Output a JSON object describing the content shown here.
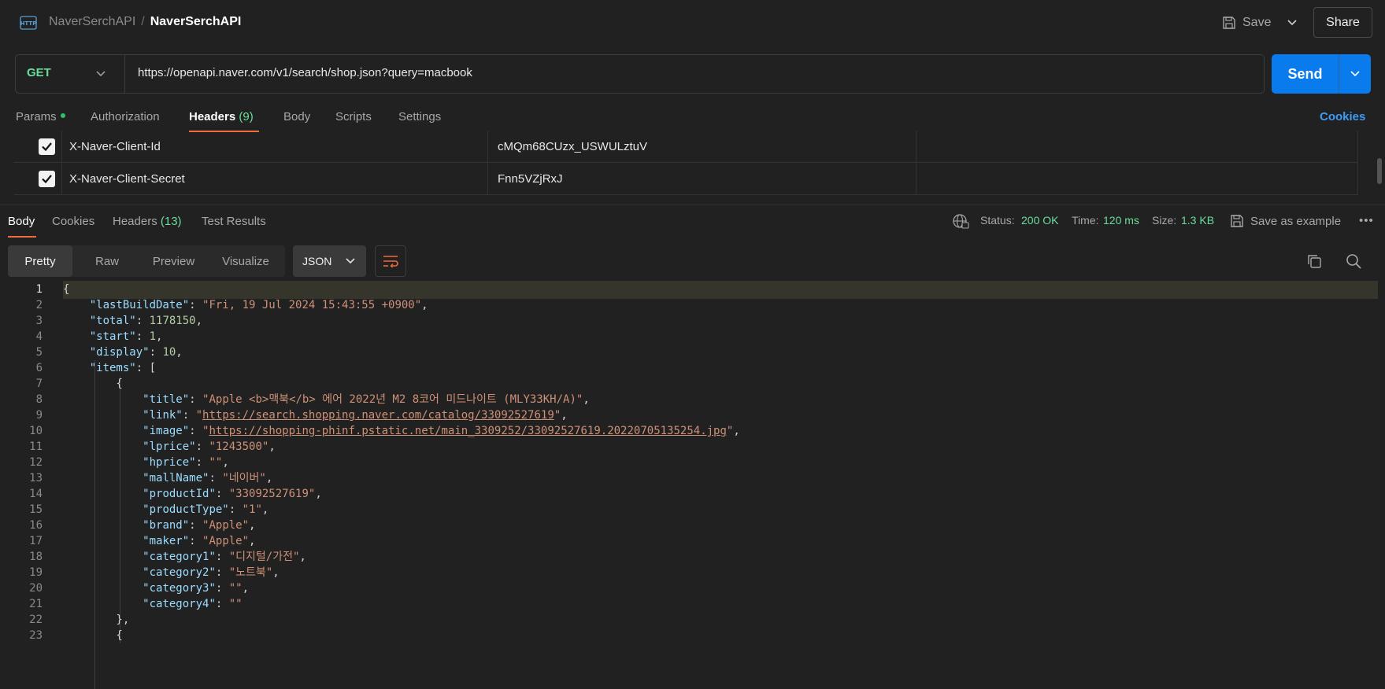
{
  "breadcrumb": {
    "parent": "NaverSerchAPI",
    "separator": "/",
    "current": "NaverSerchAPI"
  },
  "toolbar": {
    "save_label": "Save",
    "share_label": "Share"
  },
  "request": {
    "method": "GET",
    "url": "https://openapi.naver.com/v1/search/shop.json?query=macbook",
    "send_label": "Send"
  },
  "request_tabs": [
    {
      "label": "Params",
      "count": ""
    },
    {
      "label": "Authorization",
      "count": ""
    },
    {
      "label": "Headers",
      "count": "(9)"
    },
    {
      "label": "Body",
      "count": ""
    },
    {
      "label": "Scripts",
      "count": ""
    },
    {
      "label": "Settings",
      "count": ""
    }
  ],
  "active_request_tab": "Headers",
  "cookies_label": "Cookies",
  "headers": [
    {
      "key": "X-Naver-Client-Id",
      "value": "cMQm68CUzx_USWULztuV",
      "checked": true
    },
    {
      "key": "X-Naver-Client-Secret",
      "value": "Fnn5VZjRxJ",
      "checked": true
    }
  ],
  "response_tabs": [
    {
      "label": "Body",
      "count": ""
    },
    {
      "label": "Cookies",
      "count": ""
    },
    {
      "label": "Headers",
      "count": "(13)"
    },
    {
      "label": "Test Results",
      "count": ""
    }
  ],
  "response_meta": {
    "status_label": "Status:",
    "status": "200 OK",
    "time_label": "Time:",
    "time": "120 ms",
    "size_label": "Size:",
    "size": "1.3 KB",
    "save_example_label": "Save as example",
    "more_label": "•••"
  },
  "view_modes": [
    "Pretty",
    "Raw",
    "Preview",
    "Visualize"
  ],
  "active_view": "Pretty",
  "format": "JSON",
  "code_lines": [
    "1",
    "2",
    "3",
    "4",
    "5",
    "6",
    "7",
    "8",
    "9",
    "10",
    "11",
    "12",
    "13",
    "14",
    "15",
    "16",
    "17",
    "18",
    "19",
    "20",
    "21",
    "22",
    "23"
  ],
  "json": {
    "lastBuildDate": "\"Fri, 19 Jul 2024 15:43:55 +0900\"",
    "total": "1178150",
    "start": "1",
    "display": "10",
    "item": {
      "title": "\"Apple <b>맥북</b> 에어 2022년 M2 8코어 미드나이트 (MLY33KH/A)\"",
      "link": "https://search.shopping.naver.com/catalog/33092527619",
      "image": "https://shopping-phinf.pstatic.net/main_3309252/33092527619.20220705135254.jpg",
      "lprice": "\"1243500\"",
      "hprice": "\"\"",
      "mallName": "\"네이버\"",
      "productId": "\"33092527619\"",
      "productType": "\"1\"",
      "brand": "\"Apple\"",
      "maker": "\"Apple\"",
      "category1": "\"디지털/가전\"",
      "category2": "\"노트북\"",
      "category3": "\"\"",
      "category4": "\"\""
    }
  },
  "colors": {
    "accent": "#f26b3a",
    "send": "#097bed",
    "method": "#6bdd9a",
    "link": "#3d9cf5"
  }
}
